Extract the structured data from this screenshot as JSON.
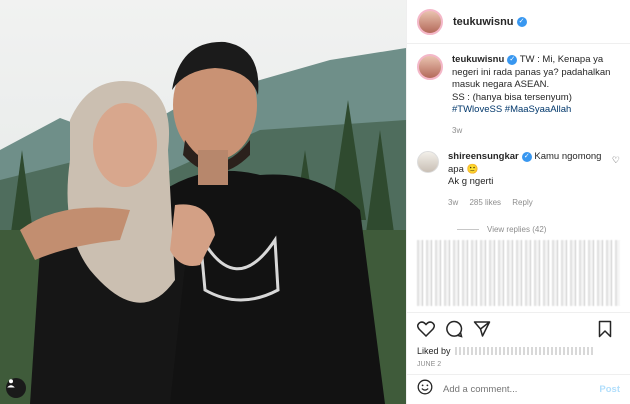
{
  "post": {
    "username": "teukuwisnu",
    "verified_icon": "verified-badge-icon",
    "caption": {
      "text": "TW : Mi, Kenapa ya negeri ini rada panas ya? padahalkan masuk negara ASEAN.",
      "line2": "SS : (hanya bisa tersenyum)",
      "hashtag1": "#TWloveSS",
      "hashtag2": "#MaaSyaaAllah",
      "time": "3w"
    },
    "comment": {
      "username": "shireensungkar",
      "line1": "Kamu ngomong apa",
      "emoji": "🙂",
      "line2": "Ak g ngerti",
      "time": "3w",
      "likes": "285 likes",
      "reply": "Reply",
      "view_replies": "View replies (42)"
    },
    "liked_by_label": "Liked by",
    "date": "JUNE 2",
    "add_comment_placeholder": "Add a comment...",
    "post_button": "Post"
  },
  "colors": {
    "accent": "#3897f0",
    "hashtag": "#00376b",
    "muted": "#8e8e8e",
    "post_disabled": "#b2dffc"
  }
}
